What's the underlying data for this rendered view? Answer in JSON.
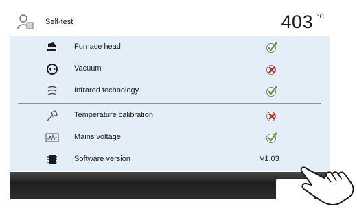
{
  "header": {
    "title": "Self-test",
    "temperature": "403",
    "unit": "°C",
    "user_icon": "user-icon"
  },
  "rows": [
    {
      "label": "Furnace head",
      "icon": "furnace-head-icon",
      "status": "ok"
    },
    {
      "label": "Vacuum",
      "icon": "vacuum-icon",
      "status": "error"
    },
    {
      "label": "Infrared technology",
      "icon": "infrared-icon",
      "status": "ok"
    },
    {
      "label": "Temperature calibration",
      "icon": "thermometer-icon",
      "status": "error"
    },
    {
      "label": "Mains voltage",
      "icon": "mains-voltage-icon",
      "status": "ok"
    },
    {
      "label": "Software version",
      "icon": "chip-icon",
      "value": "V1.03"
    }
  ],
  "colors": {
    "ok": "#5c9b35",
    "error": "#c8262f",
    "panel": "#e4eef8",
    "bar": "#262626"
  }
}
